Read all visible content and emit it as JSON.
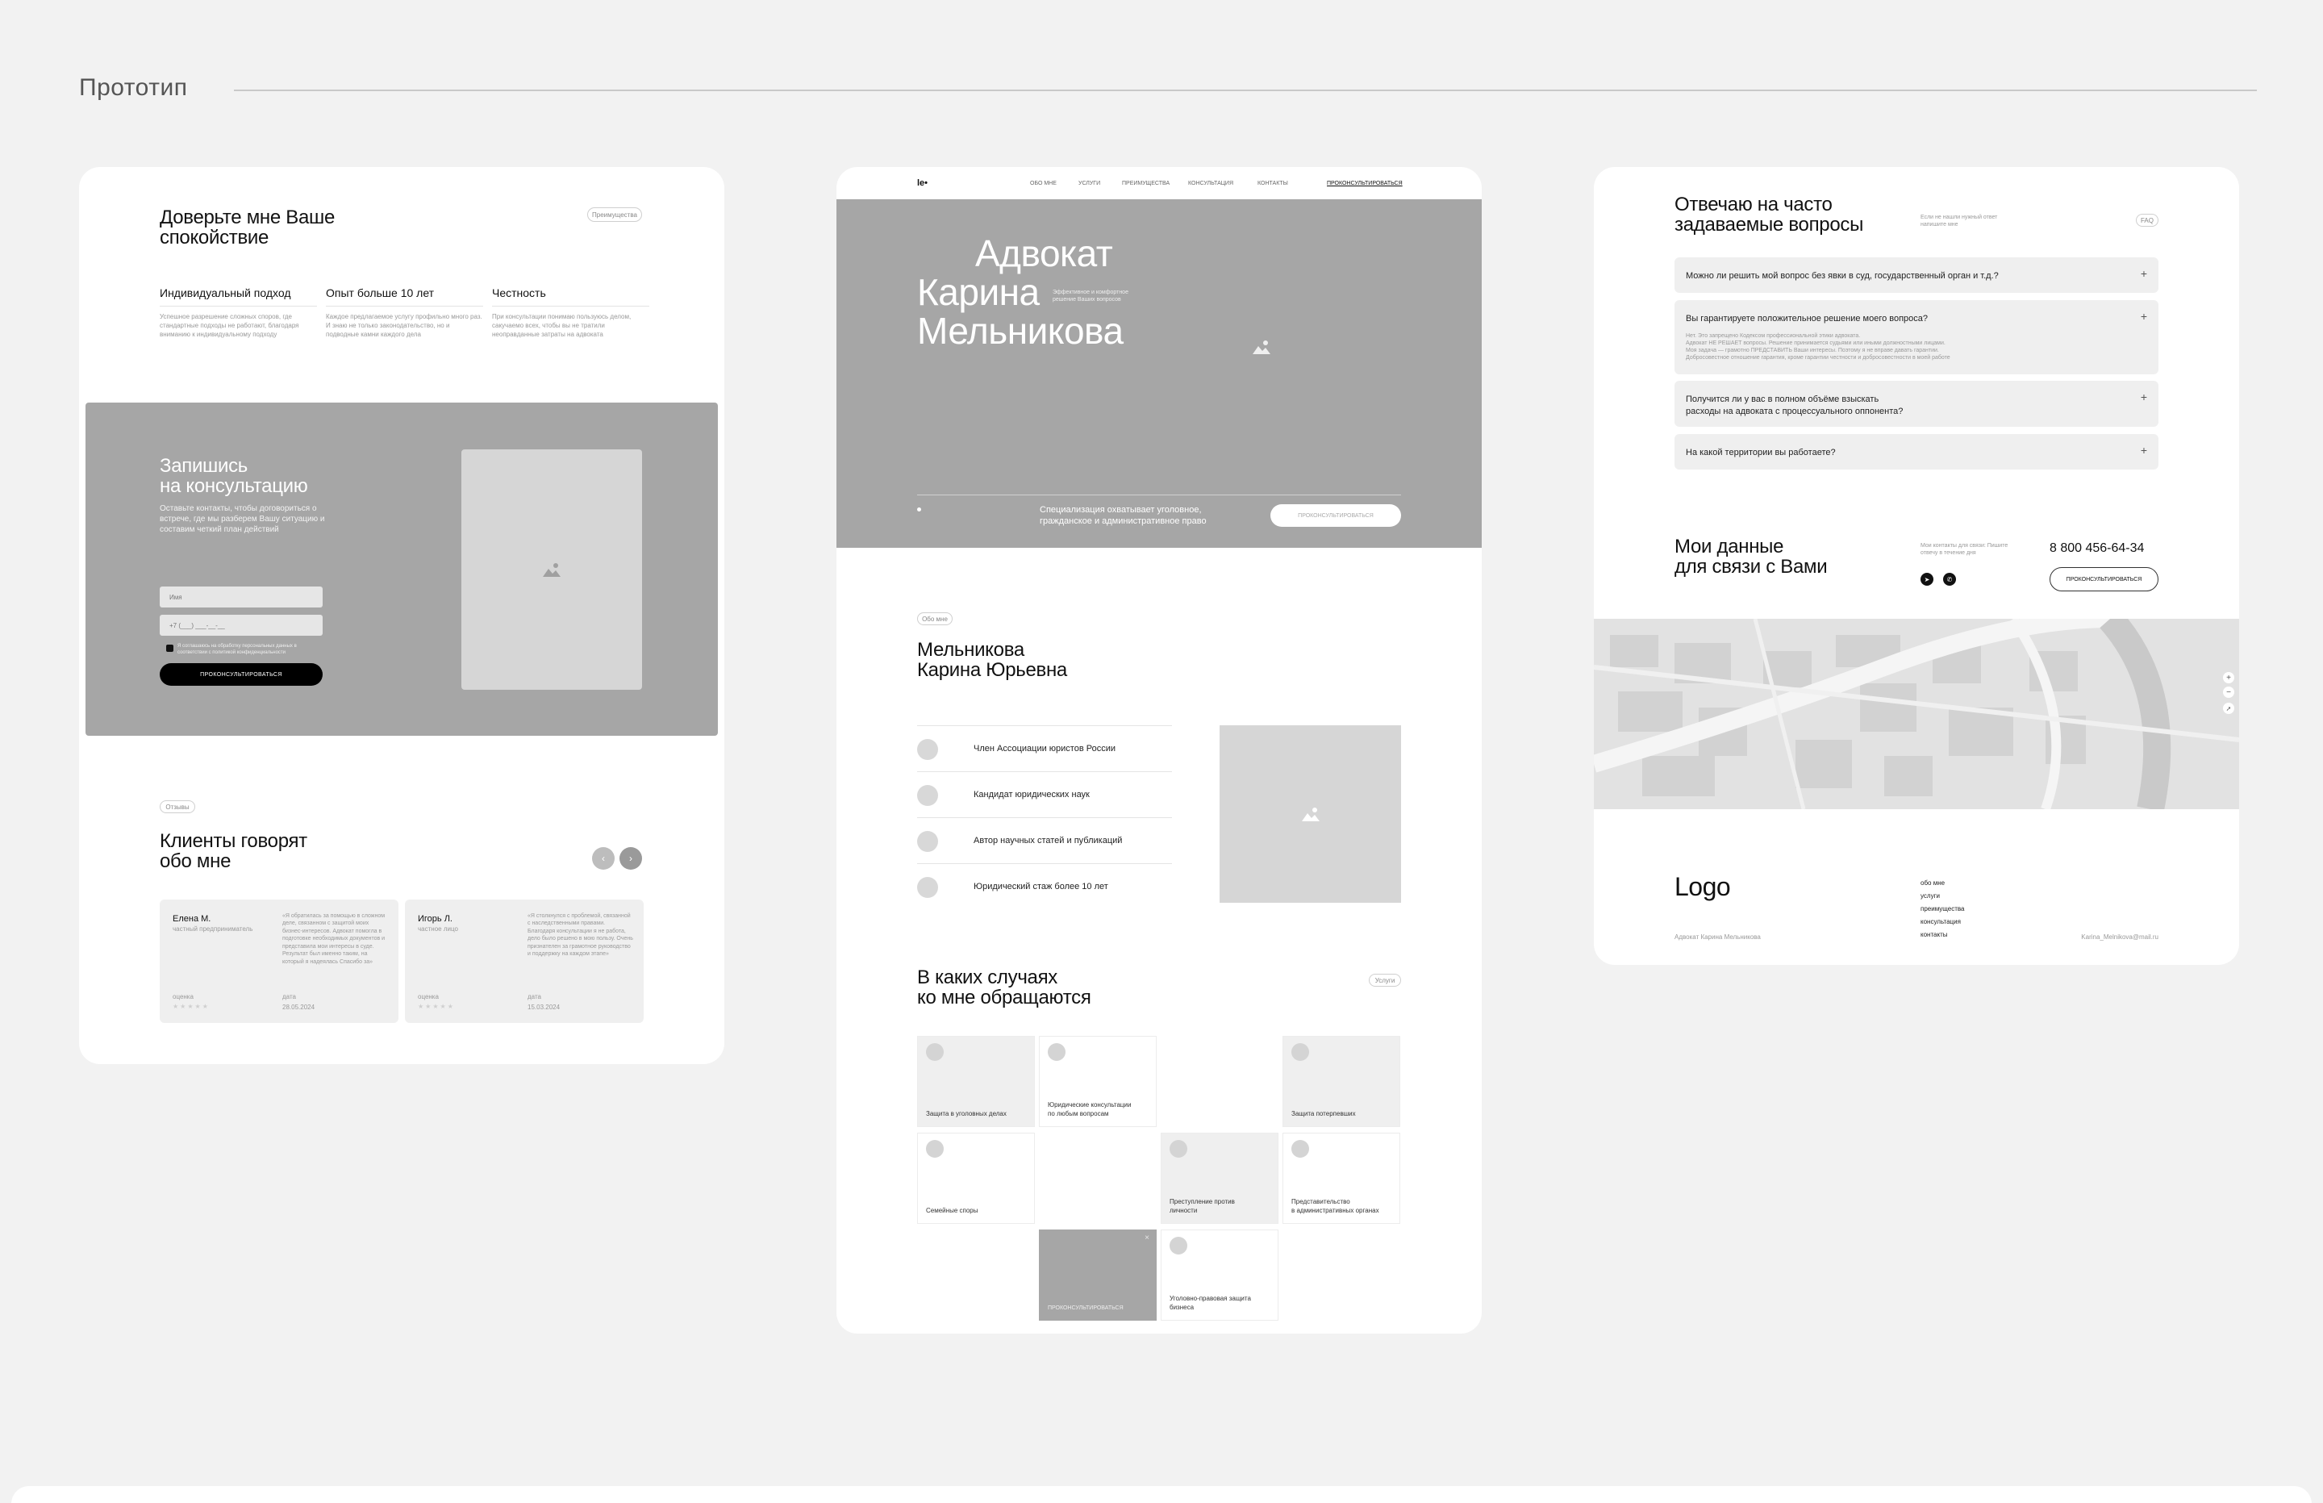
{
  "page": {
    "title": "Прототип"
  },
  "left": {
    "trust_title": "Доверьте мне Ваше\nспокойствие",
    "benefits_pill": "Преимущества",
    "benefits": [
      {
        "title": "Индивидуальный подход",
        "text": "Успешное разрешение сложных споров, где стандартные подходы не работают, благодаря вниманию к индивидуальному подходу"
      },
      {
        "title": "Опыт больше 10 лет",
        "text": "Каждое предлагаемое услугу профильно много раз. И знаю не только законодательство, но и подводные камни каждого дела"
      },
      {
        "title": "Честность",
        "text": "При консультации понимаю пользуюсь делом, сакучаемо всех, чтобы вы не тратили неоправданные затраты на адвоката"
      }
    ],
    "signup_title": "Запишись\nна консультацию",
    "signup_text": "Оставьте контакты, чтобы договориться о встрече, где мы разберем Вашу ситуацию и составим четкий план действий",
    "name_placeholder": "Имя",
    "phone_placeholder": "+7 (___) ___-__-__",
    "consent_text": "Я соглашаюсь на обработку персональных данных в соответствии с политикой конфиденциальности",
    "consult_button": "ПРОКОНСУЛЬТИРОВАТЬСЯ",
    "reviews_pill": "Отзывы",
    "reviews_title": "Клиенты говорят\nобо мне",
    "reviews": [
      {
        "name": "Елена М.",
        "role": "частный предприниматель",
        "text": "«Я обратилась за помощью в сложном деле, связанном с защитой моих бизнес-интересов. Адвокат помогла в подготовке необходимых документов и представила мои интересы в суде. Результат был именно таким, на который я надеялась Спасибо за»",
        "rating_label": "оценка",
        "date_label": "дата",
        "date": "28.05.2024"
      },
      {
        "name": "Игорь Л.",
        "role": "частное лицо",
        "text": "«Я столкнулся с проблемой, связанной с наследственными правами. Благодаря консультации я не работа, дело было решено в мою пользу. Очень признателен за грамотное руководство и поддержку на каждом этапе»",
        "rating_label": "оценка",
        "date_label": "дата",
        "date": "15.03.2024"
      }
    ],
    "stars": "★★★★★"
  },
  "middle": {
    "logo": "le•",
    "nav": [
      "ОБО МНЕ",
      "УСЛУГИ",
      "ПРЕИМУЩЕСТВА",
      "КОНСУЛЬТАЦИЯ",
      "КОНТАКТЫ"
    ],
    "nav_cta": "ПРОКОНСУЛЬТИРОВАТЬСЯ",
    "hero_line1": "Адвокат",
    "hero_line2": "Карина",
    "hero_line3": "Мельникова",
    "hero_sub": "Эффективное и комфортное решение Ваших вопросов",
    "specialization": "Специализация охватывает уголовное,\nгражданское и административное право",
    "hero_button": "ПРОКОНСУЛЬТИРОВАТЬСЯ",
    "about_pill": "Обо мне",
    "about_name": "Мельникова\nКарина Юрьевна",
    "achievements": [
      "Член Ассоциации юристов России",
      "Кандидат юридических наук",
      "Автор научных статей и публикаций",
      "Юридический стаж более 10 лет"
    ],
    "cases_title": "В каких случаях\nко мне обращаются",
    "services_pill": "Услуги",
    "services": [
      "Защита в уголовных делах",
      "Юридические консультации\nпо любым вопросам",
      "Защита потерпевших",
      "Семейные споры",
      "Преступление против\nличности",
      "Представительство\nв административных органах",
      "ПРОКОНСУЛЬТИРОВАТЬСЯ",
      "Уголовно-правовая защита\nбизнеса"
    ]
  },
  "right": {
    "faq_title": "Отвечаю на часто\nзадаваемые вопросы",
    "faq_sub": "Если не нашли нужный ответ напишите мне",
    "faq_pill": "FAQ",
    "faq": [
      {
        "q": "Можно ли решить мой вопрос без явки в суд, государственный орган и т.д.?",
        "a": ""
      },
      {
        "q": "Вы гарантируете положительное решение моего вопроса?",
        "a": "Нет. Это запрещено Кодексом профессиональной этики адвоката.\nАдвокат НЕ РЕШАЕТ вопросы. Решение принимается судьями или иными должностными лицами.\nМоя задача — грамотно ПРЕДСТАВИТЬ Ваши интересы. Поэтому я не вправе давать гарантии.\nДобросовестное отношение гарантия, кроме гарантии честности и добросовестности в моей работе"
      },
      {
        "q": "Получится ли у вас в полном объёме взыскать\nрасходы на адвоката с процессуального оппонента?",
        "a": ""
      },
      {
        "q": "На какой территории вы работаете?",
        "a": ""
      }
    ],
    "contacts_title": "Мои данные\nдля связи с Вами",
    "contacts_sub": "Мои контакты для связи: Пишите отвечу в течение дня",
    "phone": "8 800 456-64-34",
    "contacts_button": "ПРОКОНСУЛЬТИРОВАТЬСЯ",
    "footer_logo": "Logo",
    "footer_links": [
      "обо мне",
      "услуги",
      "преимущества",
      "консультация",
      "контакты"
    ],
    "footer_name": "Адвокат Карина Мельникова",
    "footer_email": "Karina_Melnikova@mail.ru"
  }
}
